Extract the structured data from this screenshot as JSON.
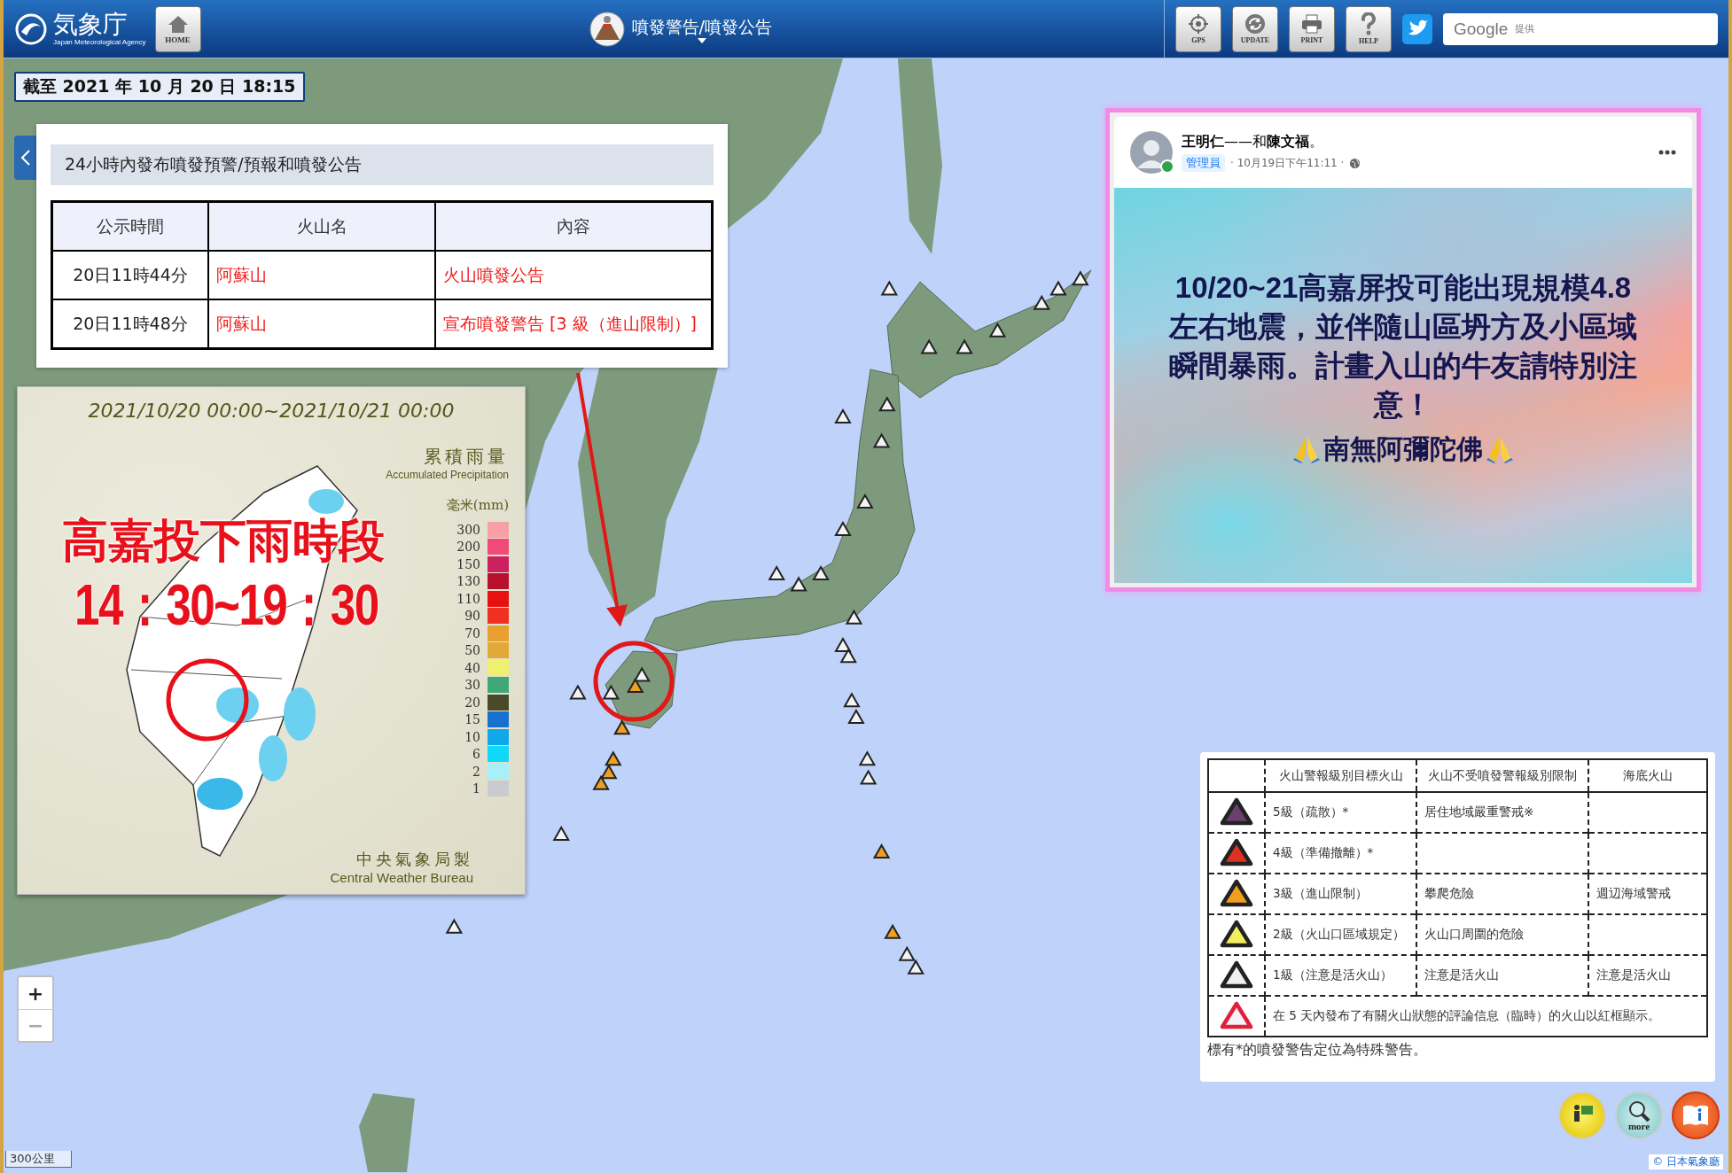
{
  "header": {
    "logo_text": "気象庁",
    "logo_subtitle": "Japan Meteorological Agency",
    "home_button": "HOME",
    "title": "噴發警告/噴發公告",
    "tool_buttons": [
      {
        "kind": "gps",
        "label": "GPS"
      },
      {
        "kind": "update",
        "label": "UPDATE"
      },
      {
        "kind": "print",
        "label": "PRINT"
      },
      {
        "kind": "help",
        "label": "HELP"
      }
    ],
    "search": {
      "brand": "Google",
      "note": "提供"
    }
  },
  "timestamp": "截至 2021 年 10 月 20 日 18:15",
  "warning_panel": {
    "title": "24小時內發布噴發預警/預報和噴發公告",
    "columns": [
      "公示時間",
      "火山名",
      "內容"
    ],
    "rows": [
      [
        "20日11時44分",
        "阿蘇山",
        "火山噴發公告"
      ],
      [
        "20日11時48分",
        "阿蘇山",
        "宣布噴發警告 [3 級（進山限制）]"
      ]
    ]
  },
  "rain_map": {
    "period": "2021/10/20 00:00~2021/10/21 00:00",
    "title": "累積雨量",
    "title_en": "Accumulated Precipitation",
    "unit": "毫米(mm)",
    "overlay_title": "高嘉投下雨時段",
    "overlay_time": "14：30~19：30",
    "scale": [
      {
        "label": "300",
        "color": "#f6a0a6"
      },
      {
        "label": "200",
        "color": "#f24a78"
      },
      {
        "label": "150",
        "color": "#cc2060"
      },
      {
        "label": "130",
        "color": "#b8102a"
      },
      {
        "label": "110",
        "color": "#e81010"
      },
      {
        "label": "90",
        "color": "#f03020"
      },
      {
        "label": "70",
        "color": "#e8a030"
      },
      {
        "label": "50",
        "color": "#e4a838"
      },
      {
        "label": "40",
        "color": "#f0f070"
      },
      {
        "label": "30",
        "color": "#40a878"
      },
      {
        "label": "20",
        "color": "#4a4a28"
      },
      {
        "label": "15",
        "color": "#1870d0"
      },
      {
        "label": "10",
        "color": "#10a8e8"
      },
      {
        "label": "6",
        "color": "#10d8f8"
      },
      {
        "label": "2",
        "color": "#a8f0f8"
      },
      {
        "label": "1",
        "color": "#c8ccd0"
      }
    ],
    "credit": "中央氣象局製",
    "credit_en": "Central Weather Bureau"
  },
  "post": {
    "author": "**王明仁**——和**陳文福**。",
    "role": "管理員",
    "meta": "· 10月19日下午11:11 ·",
    "online": true,
    "message": "10/20~21高嘉屏投可能出現規模4.8左右地震，並伴隨山區坍方及小區域瞬間暴雨。計畫入山的牛友請特別注意！",
    "prayer": "南無阿彌陀佛"
  },
  "legend": {
    "columns": [
      "火山警報級別目標火山",
      "火山不受噴發警報級別限制",
      "海底火山"
    ],
    "rows": [
      {
        "kind": "level",
        "color": "#6b3f6e",
        "target": "5級（疏散）*",
        "unrestricted": "居住地域嚴重警戒※"
      },
      {
        "kind": "level",
        "color": "#e03020",
        "target": "4級（準備撤離）*"
      },
      {
        "kind": "level",
        "color": "#f0a020",
        "target": "3級（進山限制）",
        "unrestricted": "攀爬危險",
        "submarine": "週辺海域警戒"
      },
      {
        "kind": "level",
        "color": "#f2ee60",
        "target": "2級（火山口區域規定）",
        "unrestricted": "火山口周圍的危險"
      },
      {
        "kind": "level",
        "color": "#f0f0f4",
        "target": "1級（注意是活火山）",
        "unrestricted": "注意是活火山",
        "submarine": "注意是活火山"
      },
      {
        "kind": "note",
        "color": "#e0203c",
        "text": "在 5 天內發布了有關火山狀態的評論信息（臨時）的火山以紅框顯示。"
      }
    ],
    "footnote": "標有*的噴發警告定位為特殊警告。"
  },
  "zoom": [
    "+",
    "−"
  ],
  "more_label": "more",
  "scale_bar": "300公里",
  "copyright": "© 日本氣象廳"
}
